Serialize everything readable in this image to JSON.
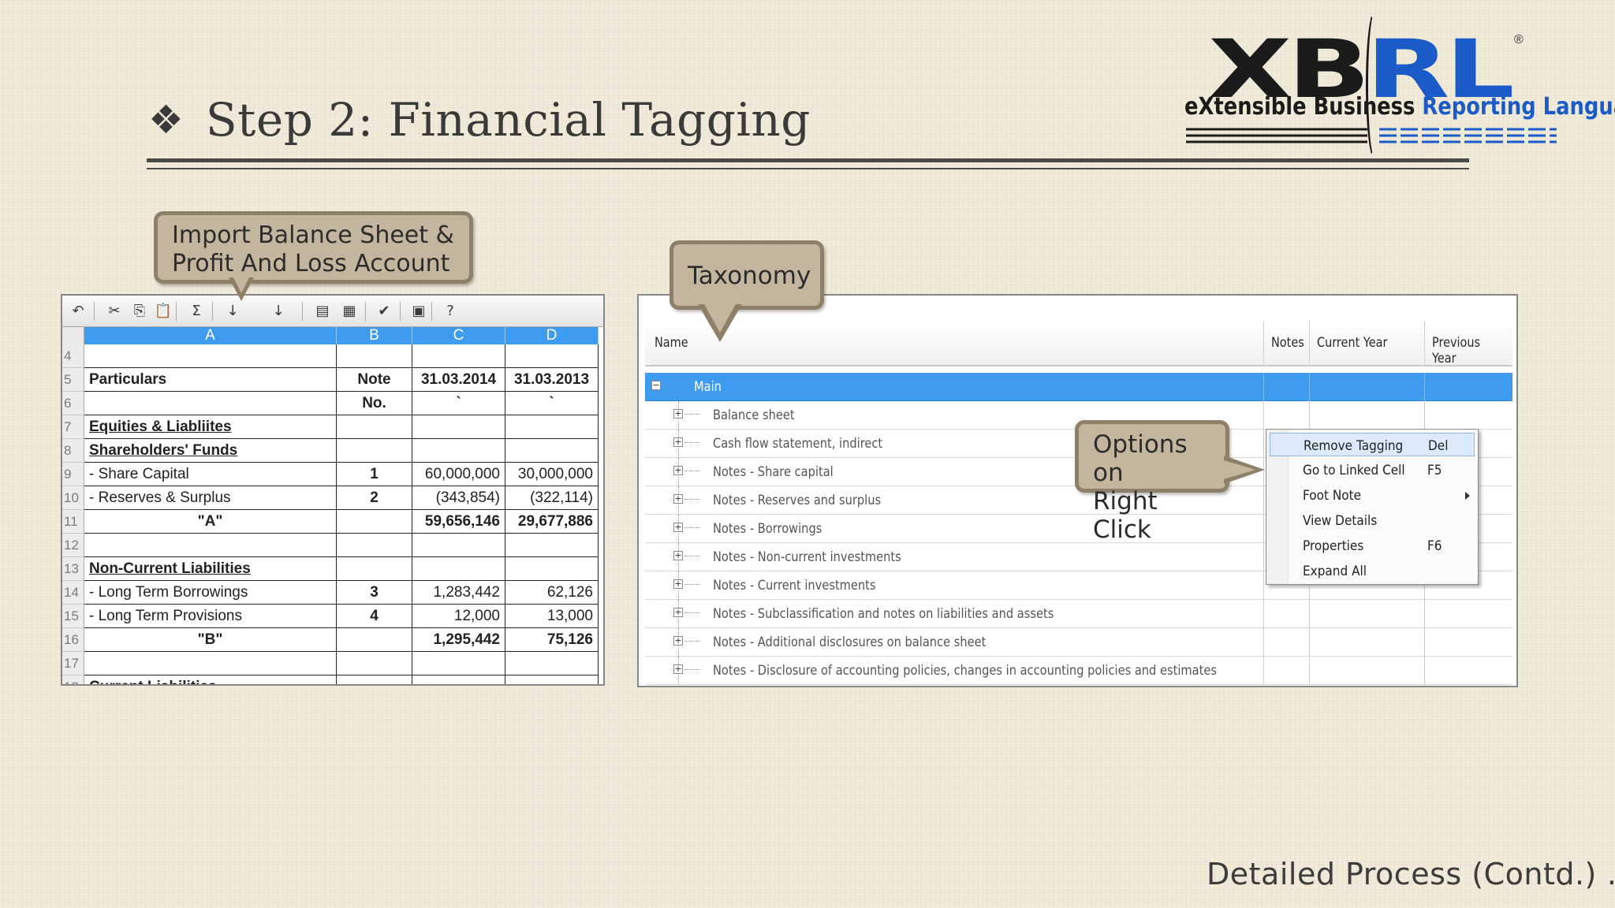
{
  "slide": {
    "bullet": "❖",
    "title": "Step 2: Financial Tagging",
    "footer": "Detailed Process (Contd.) …"
  },
  "logo": {
    "word_part1": "XB",
    "word_part2": "RL",
    "registered": "®",
    "sub_part1": "eXtensible Business",
    "sub_part2": "Reporting Language",
    "colors": {
      "dark": "#1b1b1b",
      "blue": "#1b5bc7"
    }
  },
  "callouts": {
    "import_line1": "Import Balance Sheet &",
    "import_line2": "Profit And Loss Account",
    "taxonomy": "Taxonomy",
    "options_line1": "Options on",
    "options_line2": "Right Click"
  },
  "spreadsheet": {
    "toolbar_icons": [
      "undo-icon",
      "cut-icon",
      "copy-icon",
      "paste-icon",
      "sum-icon",
      "sort-asc-icon",
      "sort-desc-icon",
      "filter-icon",
      "format-icon",
      "export-excel-icon",
      "calendar-icon",
      "help-icon"
    ],
    "toolbar_glyphs": [
      "↶",
      "✂",
      "⎘",
      "📋",
      "Σ",
      "↓",
      "↓",
      "▤",
      "▦",
      "✔",
      "▣",
      "?"
    ],
    "columns": [
      "A",
      "B",
      "C",
      "D"
    ],
    "rows": [
      {
        "n": "4",
        "a": "",
        "b": "",
        "c": "",
        "d": ""
      },
      {
        "n": "5",
        "a": "Particulars",
        "b": "Note",
        "c": "31.03.2014",
        "d": "31.03.2013"
      },
      {
        "n": "6",
        "a": "",
        "b": "No.",
        "c": "`",
        "d": "`"
      },
      {
        "n": "7",
        "a": "Equities & Liabliites",
        "b": "",
        "c": "",
        "d": ""
      },
      {
        "n": "8",
        "a": "Shareholders' Funds",
        "b": "",
        "c": "",
        "d": ""
      },
      {
        "n": "9",
        "a": "- Share Capital",
        "b": "1",
        "c": "60,000,000",
        "d": "30,000,000"
      },
      {
        "n": "10",
        "a": "- Reserves & Surplus",
        "b": "2",
        "c": "(343,854)",
        "d": "(322,114)"
      },
      {
        "n": "11",
        "a": "\"A\"",
        "b": "",
        "c": "59,656,146",
        "d": "29,677,886"
      },
      {
        "n": "12",
        "a": "",
        "b": "",
        "c": "",
        "d": ""
      },
      {
        "n": "13",
        "a": "Non-Current Liabilities",
        "b": "",
        "c": "",
        "d": ""
      },
      {
        "n": "14",
        "a": "- Long Term Borrowings",
        "b": "3",
        "c": "1,283,442",
        "d": "62,126"
      },
      {
        "n": "15",
        "a": "- Long Term Provisions",
        "b": "4",
        "c": "12,000",
        "d": "13,000"
      },
      {
        "n": "16",
        "a": "\"B\"",
        "b": "",
        "c": "1,295,442",
        "d": "75,126"
      },
      {
        "n": "17",
        "a": "",
        "b": "",
        "c": "",
        "d": ""
      },
      {
        "n": "18",
        "a": "Current Liabilities",
        "b": "",
        "c": "",
        "d": ""
      }
    ]
  },
  "taxonomy": {
    "headers": {
      "name": "Name",
      "notes": "Notes",
      "current_year": "Current Year",
      "previous_year": "Previous Year"
    },
    "main_label": "Main",
    "items": [
      "Balance sheet",
      "Cash flow statement, indirect",
      "Notes - Share capital",
      "Notes - Reserves and surplus",
      "Notes - Borrowings",
      "Notes - Non-current investments",
      "Notes - Current investments",
      "Notes - Subclassification and notes on liabilities and assets",
      "Notes - Additional disclosures on balance sheet",
      "Notes - Disclosure of accounting policies, changes in accounting policies and estimates"
    ],
    "selected_color": "#3d9bf0"
  },
  "context_menu": {
    "items": [
      {
        "label": "Remove Tagging",
        "key": "Del"
      },
      {
        "label": "Go to Linked Cell",
        "key": "F5"
      },
      {
        "label": "Foot Note",
        "key": ""
      },
      {
        "label": "View Details",
        "key": ""
      },
      {
        "label": "Properties",
        "key": "F6"
      },
      {
        "label": "Expand All",
        "key": ""
      }
    ]
  }
}
